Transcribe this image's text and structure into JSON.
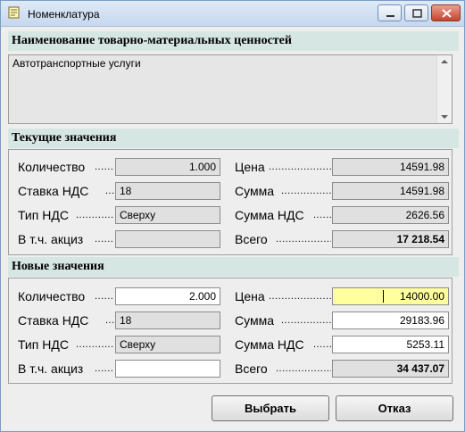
{
  "window": {
    "title": "Номенклатура",
    "icon": "document-icon"
  },
  "name_section": {
    "header": "Наименование товарно-материальных ценностей",
    "value": "Автотранспортные услуги"
  },
  "current": {
    "header": "Текущие значения",
    "labels": {
      "quantity": "Количество",
      "vat_rate": "Ставка НДС",
      "vat_type": "Тип НДС",
      "excise": "В т.ч. акциз",
      "price": "Цена",
      "sum": "Сумма",
      "vat_sum": "Сумма НДС",
      "total": "Всего"
    },
    "values": {
      "quantity": "1.000",
      "vat_rate": "18",
      "vat_type": "Сверху",
      "excise": "",
      "price": "14591.98",
      "sum": "14591.98",
      "vat_sum": "2626.56",
      "total": "17 218.54"
    }
  },
  "new": {
    "header": "Новые значения",
    "labels": {
      "quantity": "Количество",
      "vat_rate": "Ставка НДС",
      "vat_type": "Тип НДС",
      "excise": "В т.ч. акциз",
      "price": "Цена",
      "sum": "Сумма",
      "vat_sum": "Сумма НДС",
      "total": "Всего"
    },
    "values": {
      "quantity": "2.000",
      "vat_rate": "18",
      "vat_type": "Сверху",
      "excise": "",
      "price": "14000.00",
      "sum": "29183.96",
      "vat_sum": "5253.11",
      "total": "34 437.07"
    }
  },
  "buttons": {
    "select": "Выбрать",
    "cancel": "Отказ"
  },
  "colors": {
    "section_header_bg": "#d6e6e2",
    "highlight_field": "#ffff9e",
    "readonly_field": "#e0e0e0"
  }
}
